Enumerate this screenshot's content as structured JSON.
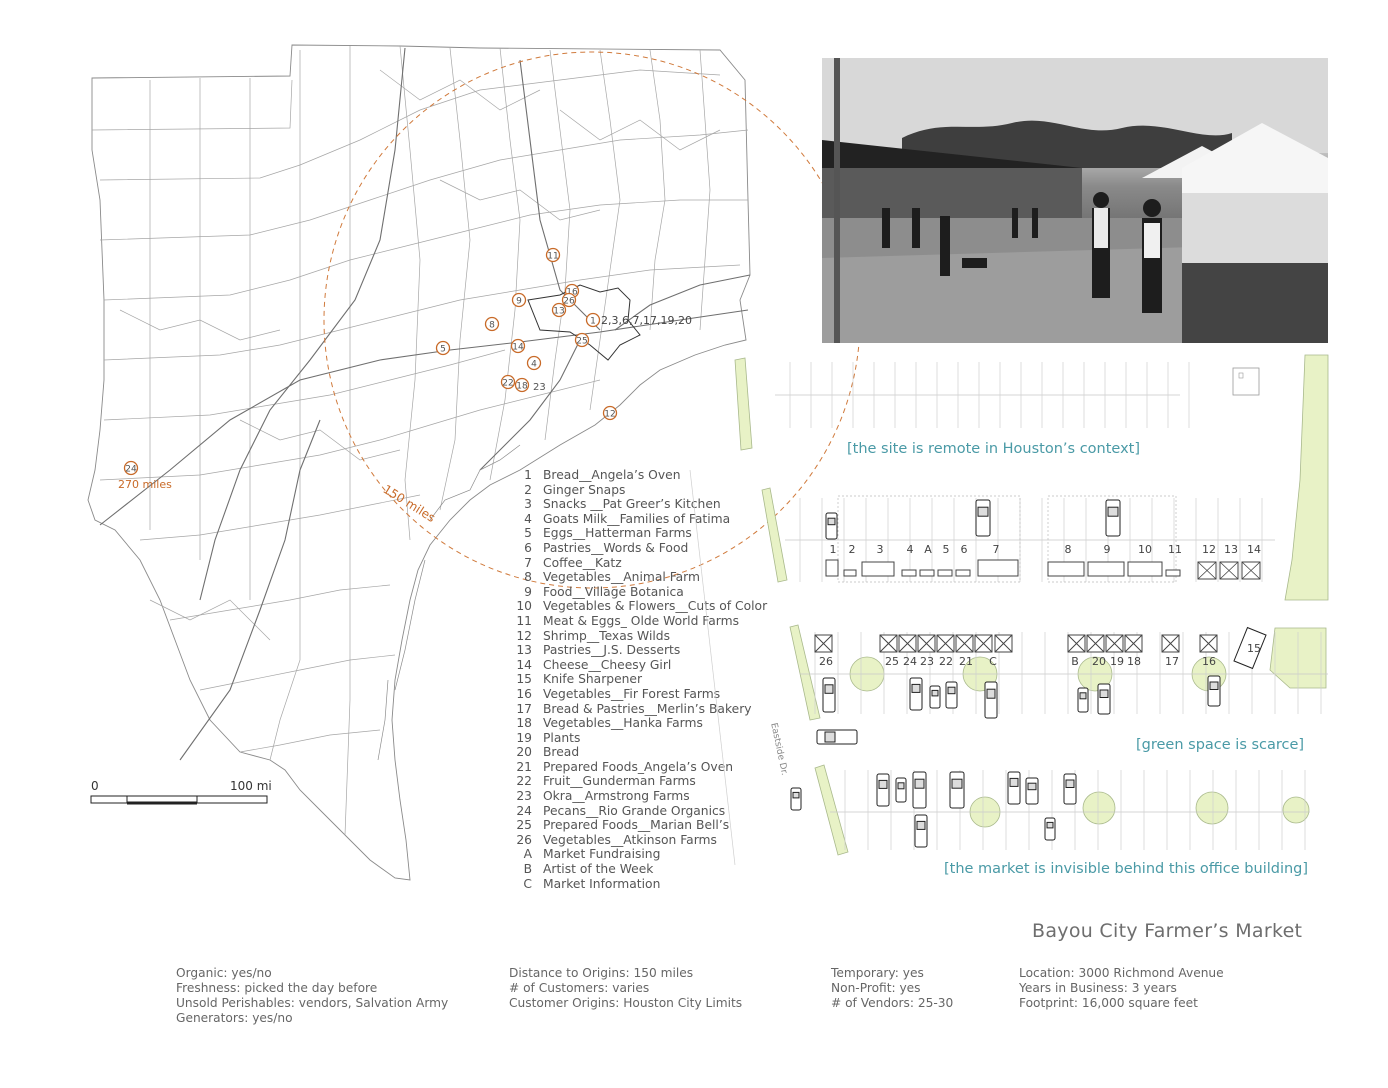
{
  "title": "Bayou City Farmer’s Market",
  "captions": {
    "remote": "[the site is remote in Houston’s context]",
    "green": "[green space is scarce]",
    "invisible": "[the market is invisible behind this office building]"
  },
  "map": {
    "radius_label": "150 miles",
    "far_label": "270 miles",
    "far_marker": "24",
    "cluster_label": "2,3,6,7,17,19,20",
    "scale_zero": "0",
    "scale_end": "100 mi",
    "street": "Eastside Dr.",
    "colors": {
      "accent": "#c86a28",
      "caption": "#4a9aa6",
      "green": "#e8f2c6"
    },
    "markers": [
      {
        "label": "11"
      },
      {
        "label": "16"
      },
      {
        "label": "26"
      },
      {
        "label": "9"
      },
      {
        "label": "13"
      },
      {
        "label": "1"
      },
      {
        "label": "8"
      },
      {
        "label": "25"
      },
      {
        "label": "5"
      },
      {
        "label": "14"
      },
      {
        "label": "4"
      },
      {
        "label": "22"
      },
      {
        "label": "18"
      },
      {
        "label": "12"
      }
    ],
    "marker_extra": "23"
  },
  "legend": [
    {
      "num": "1",
      "text": "Bread__Angela’s Oven"
    },
    {
      "num": "2",
      "text": "Ginger Snaps"
    },
    {
      "num": "3",
      "text": "Snacks __Pat Greer’s Kitchen"
    },
    {
      "num": "4",
      "text": "Goats Milk__Families of Fatima"
    },
    {
      "num": "5",
      "text": "Eggs__Hatterman Farms"
    },
    {
      "num": "6",
      "text": "Pastries__Words & Food"
    },
    {
      "num": "7",
      "text": "Coffee__Katz"
    },
    {
      "num": "8",
      "text": "Vegetables__Animal Farm"
    },
    {
      "num": "9",
      "text": "Food__Village Botanica"
    },
    {
      "num": "10",
      "text": "Vegetables & Flowers__Cuts of Color"
    },
    {
      "num": "11",
      "text": "Meat & Eggs_ Olde World Farms"
    },
    {
      "num": "12",
      "text": "Shrimp__Texas Wilds"
    },
    {
      "num": "13",
      "text": "Pastries__J.S. Desserts"
    },
    {
      "num": "14",
      "text": "Cheese__Cheesy Girl"
    },
    {
      "num": "15",
      "text": "Knife Sharpener"
    },
    {
      "num": "16",
      "text": "Vegetables__Fir Forest Farms"
    },
    {
      "num": "17",
      "text": "Bread & Pastries__Merlin’s Bakery"
    },
    {
      "num": "18",
      "text": "Vegetables__Hanka Farms"
    },
    {
      "num": "19",
      "text": "Plants"
    },
    {
      "num": "20",
      "text": "Bread"
    },
    {
      "num": "21",
      "text": "Prepared Foods_Angela’s Oven"
    },
    {
      "num": "22",
      "text": "Fruit__Gunderman Farms"
    },
    {
      "num": "23",
      "text": "Okra__Armstrong Farms"
    },
    {
      "num": "24",
      "text": "Pecans__Rio Grande Organics"
    },
    {
      "num": "25",
      "text": "Prepared Foods__Marian Bell’s"
    },
    {
      "num": "26",
      "text": "Vegetables__Atkinson Farms"
    },
    {
      "num": "A",
      "text": "Market Fundraising"
    },
    {
      "num": "B",
      "text": "Artist of the Week"
    },
    {
      "num": "C",
      "text": "Market Information"
    }
  ],
  "plan": {
    "row1_labels": [
      "1",
      "2",
      "3",
      "4",
      "A",
      "5",
      "6",
      "7",
      "8",
      "9",
      "10",
      "11",
      "12",
      "13",
      "14"
    ],
    "row2_labels": [
      "26",
      "25",
      "24",
      "23",
      "22",
      "21",
      "C",
      "B",
      "20",
      "19",
      "18",
      "17",
      "16",
      "15"
    ]
  },
  "stats": {
    "col1": [
      "Organic: yes/no",
      "Freshness: picked the day before",
      "Unsold Perishables: vendors, Salvation Army",
      "Generators: yes/no"
    ],
    "col2": [
      "Distance to Origins: 150 miles",
      "# of Customers: varies",
      "Customer Origins: Houston City Limits"
    ],
    "col3": [
      "Temporary: yes",
      "Non-Profit: yes",
      "# of Vendors: 25-30"
    ],
    "col4": [
      "Location: 3000 Richmond Avenue",
      "Years in Business: 3 years",
      "Footprint:  16,000 square feet"
    ]
  }
}
